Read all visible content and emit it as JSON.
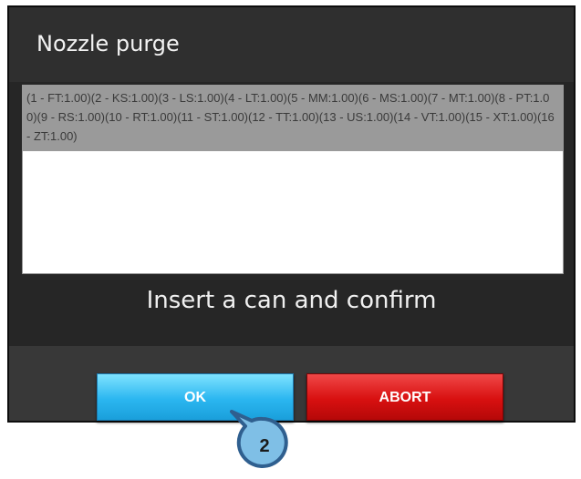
{
  "dialog": {
    "title": "Nozzle purge",
    "list_text": "(1 - FT:1.00)(2 - KS:1.00)(3 - LS:1.00)(4 - LT:1.00)(5 - MM:1.00)(6 - MS:1.00)(7 - MT:1.00)(8 - PT:1.00)(9 - RS:1.00)(10 - RT:1.00)(11 - ST:1.00)(12 - TT:1.00)(13 - US:1.00)(14 - VT:1.00)(15 - XT:1.00)(16 - ZT:1.00)",
    "instruction": "Insert a can and confirm",
    "ok_label": "OK",
    "abort_label": "ABORT"
  },
  "callout": {
    "number": "2"
  },
  "colors": {
    "ok_button": "#2bb6f0",
    "abort_button": "#d81010",
    "callout_fill": "#7fbfe6",
    "callout_border": "#2f5f8f"
  }
}
